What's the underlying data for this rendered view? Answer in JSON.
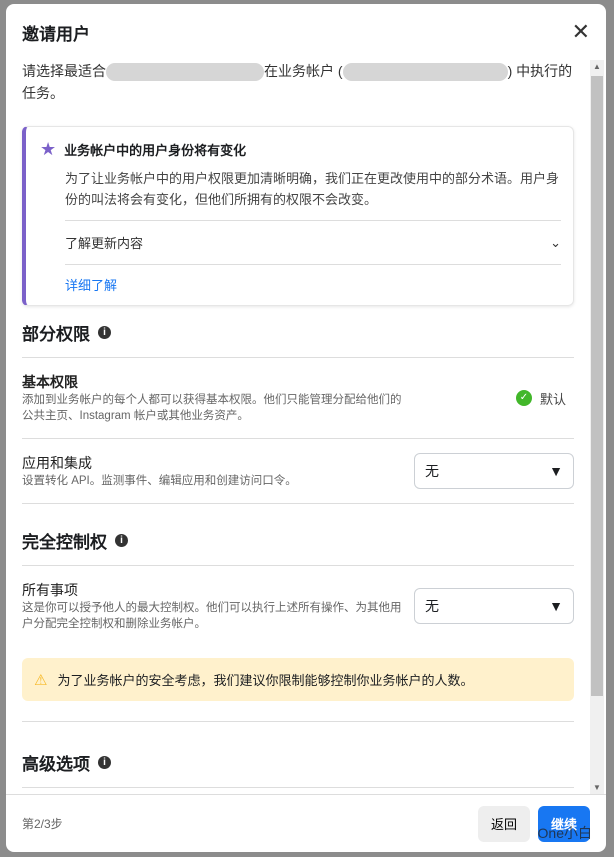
{
  "dialog": {
    "title": "邀请用户",
    "intro_a": "请选择最适合",
    "intro_b": "在业务帐户 (",
    "intro_c": ") 中执行的任务。"
  },
  "notice": {
    "title": "业务帐户中的用户身份将有变化",
    "body": "为了让业务帐户中的用户权限更加清晰明确，我们正在更改使用中的部分术语。用户身份的叫法将会有变化，但他们所拥有的权限不会改变。",
    "accordion": "了解更新内容",
    "link": "详细了解"
  },
  "partial": {
    "heading": "部分权限",
    "basic_title": "基本权限",
    "basic_desc": "添加到业务帐户的每个人都可以获得基本权限。他们只能管理分配给他们的公共主页、Instagram 帐户或其他业务资产。",
    "basic_value": "默认",
    "apps_title": "应用和集成",
    "apps_desc": "设置转化 API。监测事件、编辑应用和创建访问口令。",
    "apps_value": "无"
  },
  "full": {
    "heading": "完全控制权",
    "all_title": "所有事项",
    "all_desc": "这是你可以授予他人的最大控制权。他们可以执行上述所有操作、为其他用户分配完全控制权和删除业务帐户。",
    "all_value": "无",
    "warning": "为了业务帐户的安全考虑，我们建议你限制能够控制你业务帐户的人数。"
  },
  "advanced": {
    "heading": "高级选项"
  },
  "footer": {
    "step": "第2/3步",
    "back": "返回",
    "next": "继续"
  },
  "watermark": "One小白"
}
